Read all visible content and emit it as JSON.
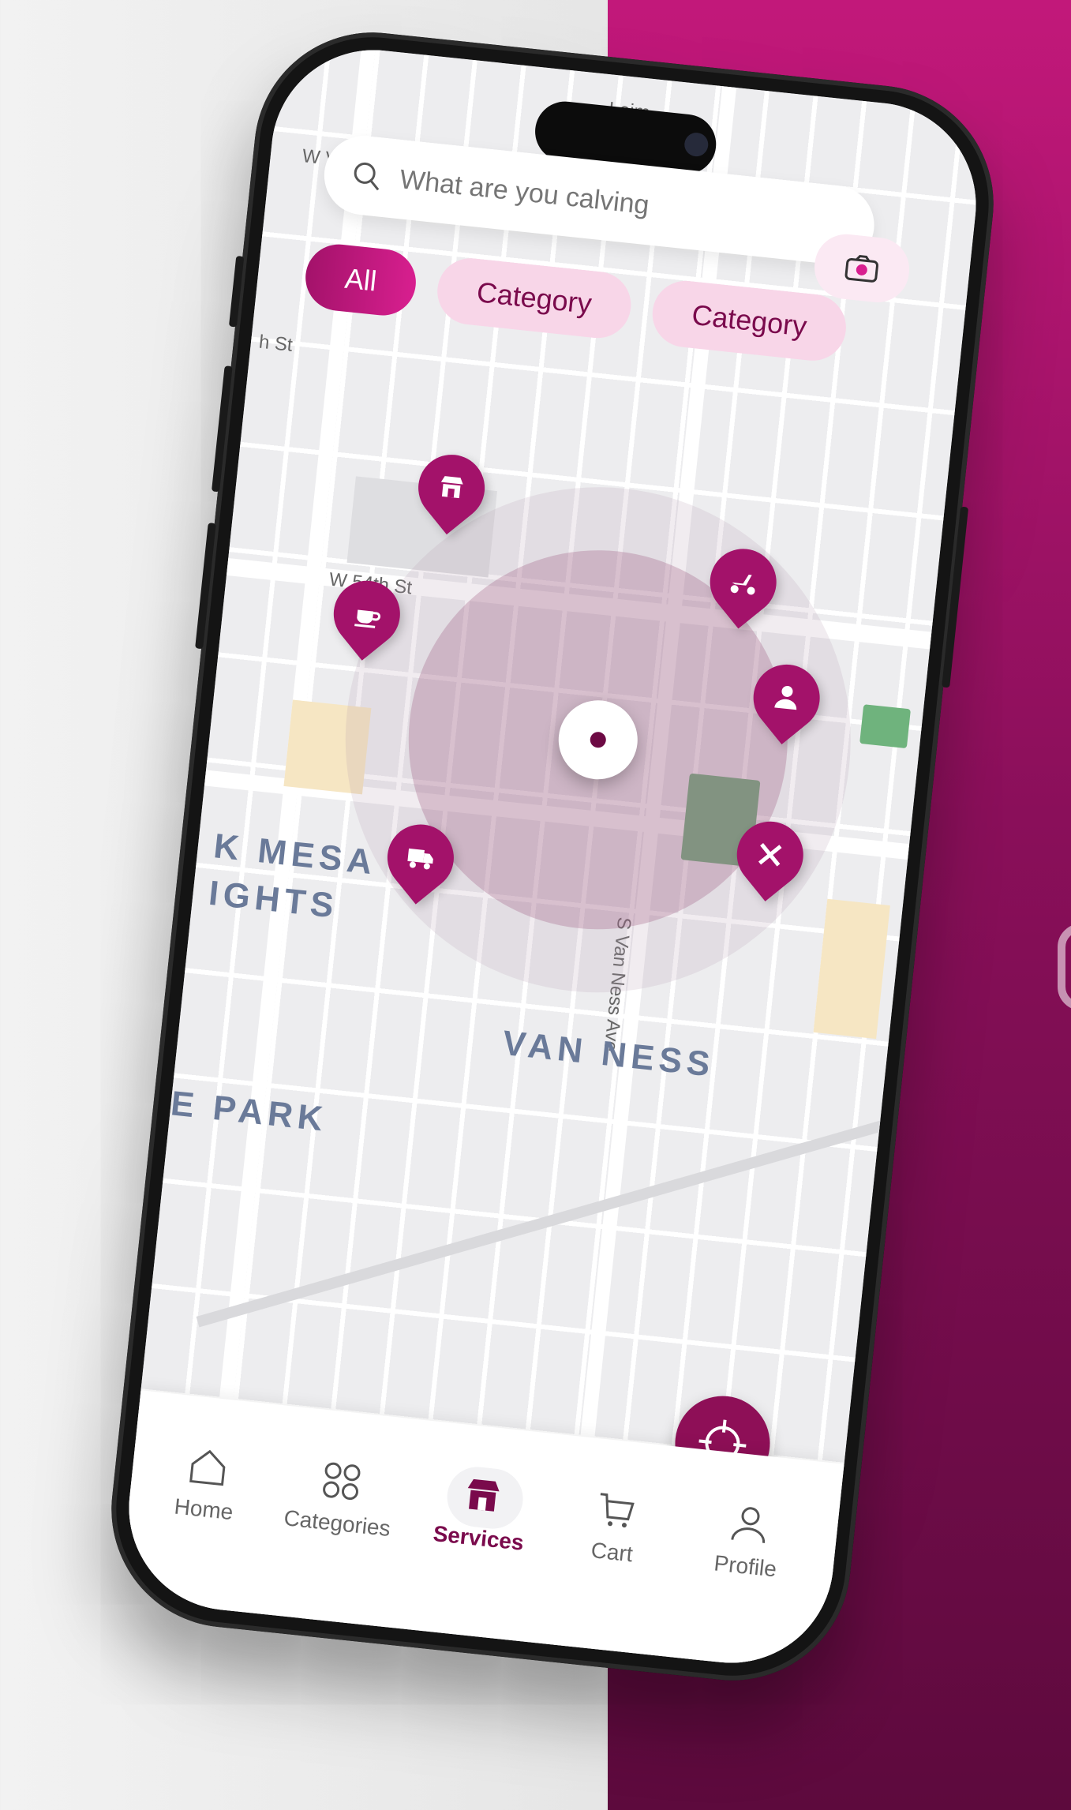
{
  "search": {
    "placeholder": "What are you calving",
    "camera_icon": "camera-icon"
  },
  "chips": [
    {
      "label": "All",
      "active": true
    },
    {
      "label": "Category",
      "active": false
    },
    {
      "label": "Category",
      "active": false
    }
  ],
  "map": {
    "streets": [
      "W Vernon Ave",
      "Leim",
      "h St",
      "W 54th St",
      "S Van Ness Ave"
    ],
    "areas": [
      "K MESA",
      "IGHTS",
      "VAN NESS",
      "E PARK"
    ],
    "pins": [
      {
        "icon": "store-icon"
      },
      {
        "icon": "scooter-icon"
      },
      {
        "icon": "coffee-icon"
      },
      {
        "icon": "person-icon"
      },
      {
        "icon": "truck-icon"
      },
      {
        "icon": "utensils-icon"
      }
    ]
  },
  "locate_button": {
    "icon": "crosshair-icon"
  },
  "tabbar": {
    "items": [
      {
        "label": "Home",
        "icon": "home-icon"
      },
      {
        "label": "Categories",
        "icon": "grid-icon"
      },
      {
        "label": "Services",
        "icon": "store-icon",
        "active": true
      },
      {
        "label": "Cart",
        "icon": "cart-icon"
      },
      {
        "label": "Profile",
        "icon": "user-icon"
      }
    ]
  },
  "colors": {
    "brand": "#a3126a",
    "brand_dark": "#6d0a44",
    "chip_bg": "#f8d6e8",
    "park": "#6fb37d"
  }
}
